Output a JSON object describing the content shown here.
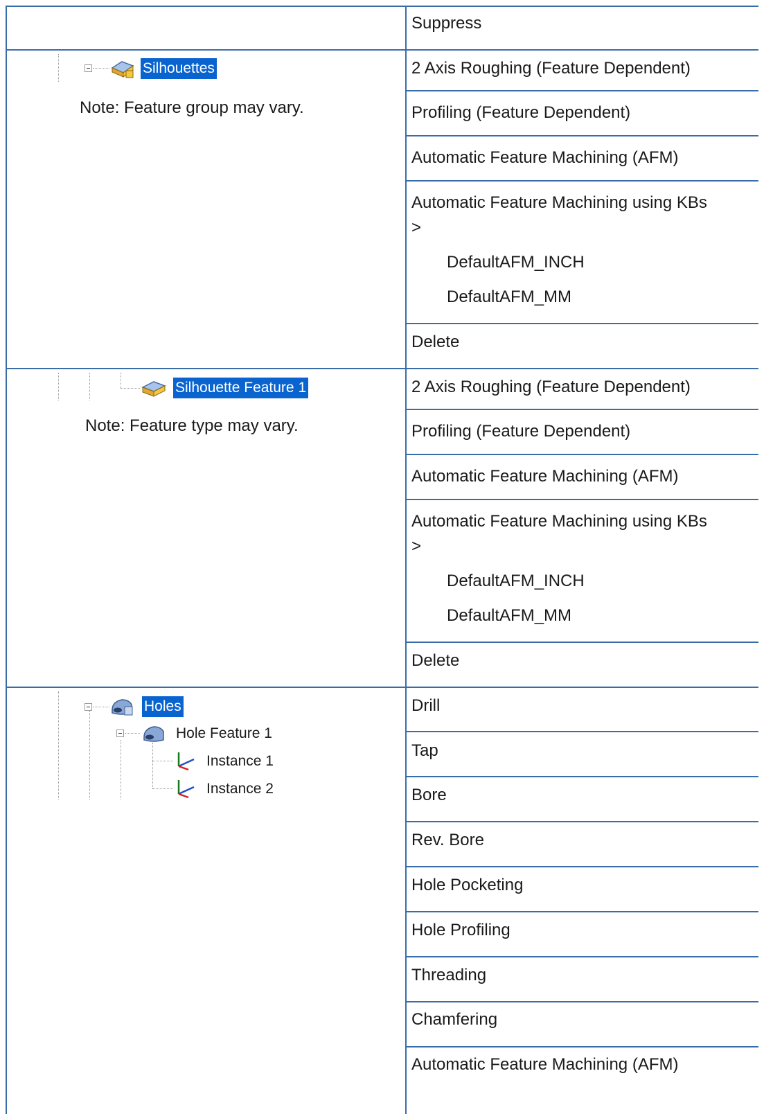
{
  "table": {
    "header_right": "Suppress",
    "rows": [
      {
        "tree": {
          "label": "Silhouettes"
        },
        "note": "Note: Feature group may vary.",
        "menu": [
          "2 Axis Roughing (Feature Dependent)",
          "Profiling (Feature Dependent)",
          "Automatic Feature Machining (AFM)",
          "Automatic Feature Machining using KBs",
          ">",
          "DefaultAFM_INCH",
          "DefaultAFM_MM",
          "Delete"
        ]
      },
      {
        "tree": {
          "label": "Silhouette Feature 1"
        },
        "note": "Note: Feature type may vary.",
        "menu": [
          "2 Axis Roughing (Feature Dependent)",
          "Profiling (Feature Dependent)",
          "Automatic Feature Machining (AFM)",
          "Automatic Feature Machining using KBs",
          ">",
          "DefaultAFM_INCH",
          "DefaultAFM_MM",
          "Delete"
        ]
      },
      {
        "tree": {
          "label": "Holes",
          "child": "Hole Feature 1",
          "instances": [
            "Instance 1",
            "Instance 2"
          ]
        },
        "menu": [
          "Drill",
          "Tap",
          "Bore",
          "Rev. Bore",
          "Hole Pocketing",
          "Hole Profiling",
          "Threading",
          "Chamfering",
          "Automatic Feature Machining (AFM)"
        ]
      }
    ]
  },
  "colors": {
    "border": "#3a6da8",
    "selection": "#0a64d0"
  },
  "icons": [
    "silhouette-group-icon",
    "silhouette-feature-icon",
    "hole-group-icon",
    "hole-feature-icon",
    "instance-axis-icon"
  ]
}
